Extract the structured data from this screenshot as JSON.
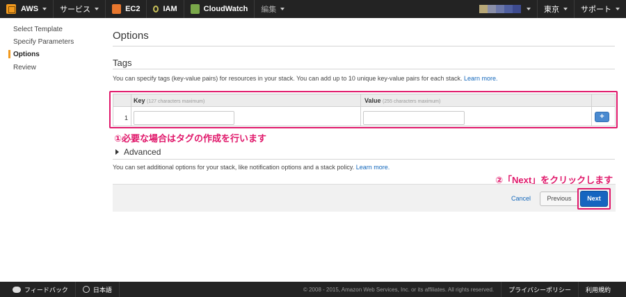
{
  "topbar": {
    "aws_label": "AWS",
    "services_label": "サービス",
    "ec2_label": "EC2",
    "iam_label": "IAM",
    "cloudwatch_label": "CloudWatch",
    "edit_label": "編集",
    "region_label": "東京",
    "support_label": "サポート",
    "account_colors": [
      "#b8a878",
      "#8a8fa8",
      "#6b77a8",
      "#4f5fa0",
      "#3d4b8f"
    ]
  },
  "sidebar": {
    "items": [
      {
        "label": "Select Template"
      },
      {
        "label": "Specify Parameters"
      },
      {
        "label": "Options"
      },
      {
        "label": "Review"
      }
    ],
    "active_index": 2
  },
  "main": {
    "page_title": "Options",
    "tags_heading": "Tags",
    "tags_description": "You can specify tags (key-value pairs) for resources in your stack. You can add up to 10 unique key-value pairs for each stack.",
    "tags_learn_more": "Learn more.",
    "table": {
      "key_header": "Key",
      "key_hint": "(127 characters maximum)",
      "value_header": "Value",
      "value_hint": "(255 characters maximum)",
      "rows": [
        {
          "number": "1",
          "key": "",
          "value": ""
        }
      ],
      "add_button_label": "+"
    },
    "advanced_label": "Advanced",
    "advanced_description": "You can set additional options for your stack, like notification options and a stack policy.",
    "advanced_learn_more": "Learn more."
  },
  "annotations": {
    "tags_note": "①必要な場合はタグの作成を行います",
    "next_note": "②「Next」をクリックします",
    "highlight_color": "#e0176a"
  },
  "actions": {
    "cancel_label": "Cancel",
    "previous_label": "Previous",
    "next_label": "Next"
  },
  "footer": {
    "feedback_label": "フィードバック",
    "language_label": "日本語",
    "copyright": "© 2008 - 2015, Amazon Web Services, Inc. or its affiliates. All rights reserved.",
    "privacy_label": "プライバシーポリシー",
    "terms_label": "利用規約"
  }
}
